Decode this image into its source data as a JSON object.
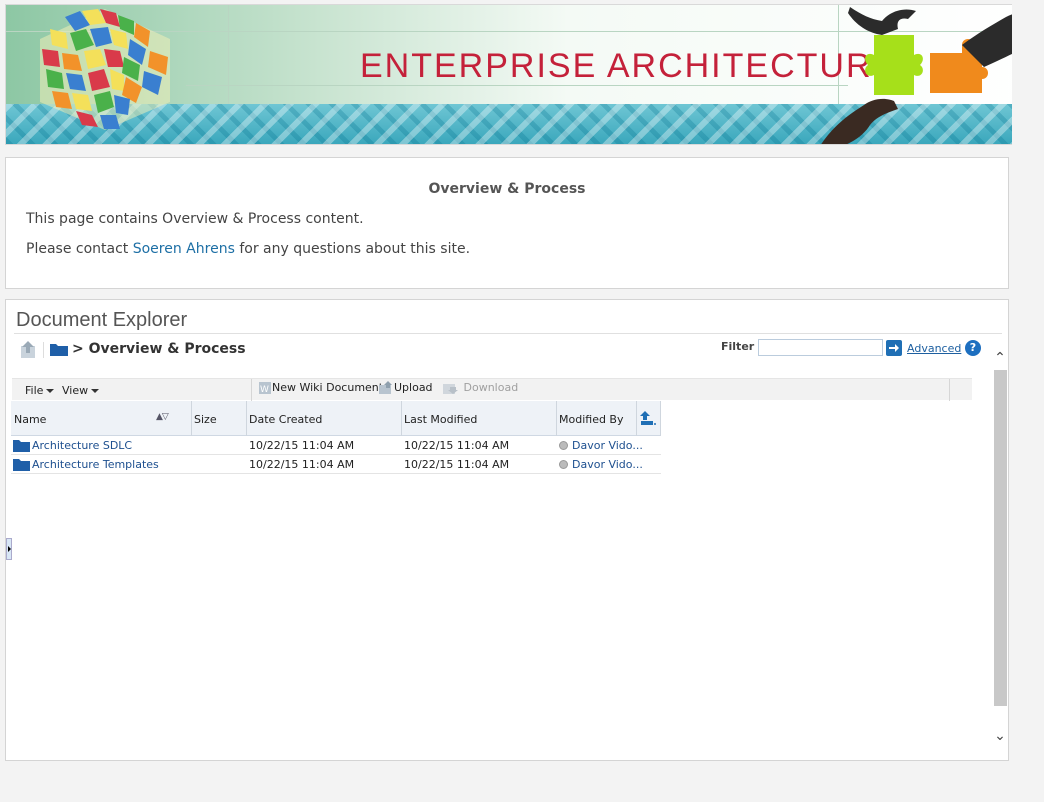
{
  "banner": {
    "title": "ENTERPRISE ARCHITECTURE"
  },
  "overview": {
    "heading": "Overview & Process",
    "line1": "This page contains Overview & Process content.",
    "line2_prefix": "Please contact ",
    "contact_name": "Soeren Ahrens",
    "line2_suffix": " for any questions about this site."
  },
  "explorer": {
    "title": "Document Explorer",
    "breadcrumb": "> Overview & Process",
    "filter_label": "Filter",
    "filter_value": "",
    "advanced_label": "Advanced",
    "help_label": "?",
    "toolbar": {
      "file": "File",
      "view": "View",
      "new_wiki": "New Wiki Document",
      "upload": "Upload",
      "download": "Download"
    },
    "columns": {
      "name": "Name",
      "size": "Size",
      "date_created": "Date Created",
      "last_modified": "Last Modified",
      "modified_by": "Modified By"
    },
    "rows": [
      {
        "name": "Architecture SDLC",
        "size": "",
        "created": "10/22/15 11:04 AM",
        "modified": "10/22/15 11:04 AM",
        "modified_by": "Davor Vido..."
      },
      {
        "name": "Architecture Templates",
        "size": "",
        "created": "10/22/15 11:04 AM",
        "modified": "10/22/15 11:04 AM",
        "modified_by": "Davor Vido..."
      }
    ]
  },
  "colors": {
    "banner_title": "#c4213a",
    "link": "#1d6fa5",
    "folder": "#1f5fa8",
    "accent": "#1f6fb5"
  }
}
